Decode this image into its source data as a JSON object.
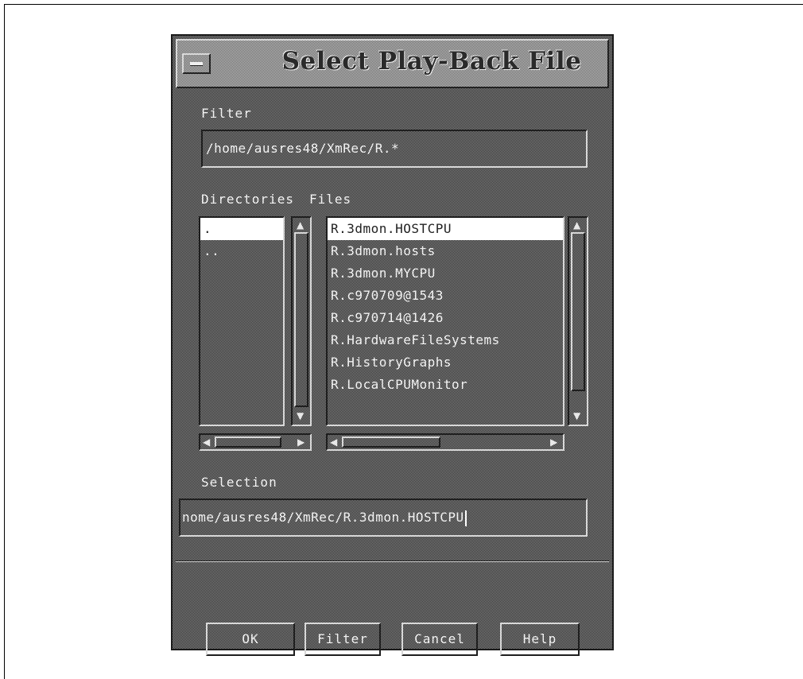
{
  "dialog": {
    "title": "Select Play-Back File",
    "filter_label": "Filter",
    "filter_value": "/home/ausres48/XmRec/R.*",
    "directories_label": "Directories",
    "files_label": "Files",
    "directories": [
      ".",
      ".."
    ],
    "selected_directory": ".",
    "files": [
      "R.3dmon.HOSTCPU",
      "R.3dmon.hosts",
      "R.3dmon.MYCPU",
      "R.c970709@1543",
      "R.c970714@1426",
      "R.HardwareFileSystems",
      "R.HistoryGraphs",
      "R.LocalCPUMonitor"
    ],
    "selected_file": "R.3dmon.HOSTCPU",
    "selection_label": "Selection",
    "selection_value": "nome/ausres48/XmRec/R.3dmon.HOSTCPU",
    "buttons": {
      "ok": "OK",
      "filter": "Filter",
      "cancel": "Cancel",
      "help": "Help"
    }
  },
  "icons": {
    "window_menu": "window-menu-icon",
    "arrow_up": "▲",
    "arrow_down": "▼",
    "arrow_left": "◀",
    "arrow_right": "▶"
  }
}
